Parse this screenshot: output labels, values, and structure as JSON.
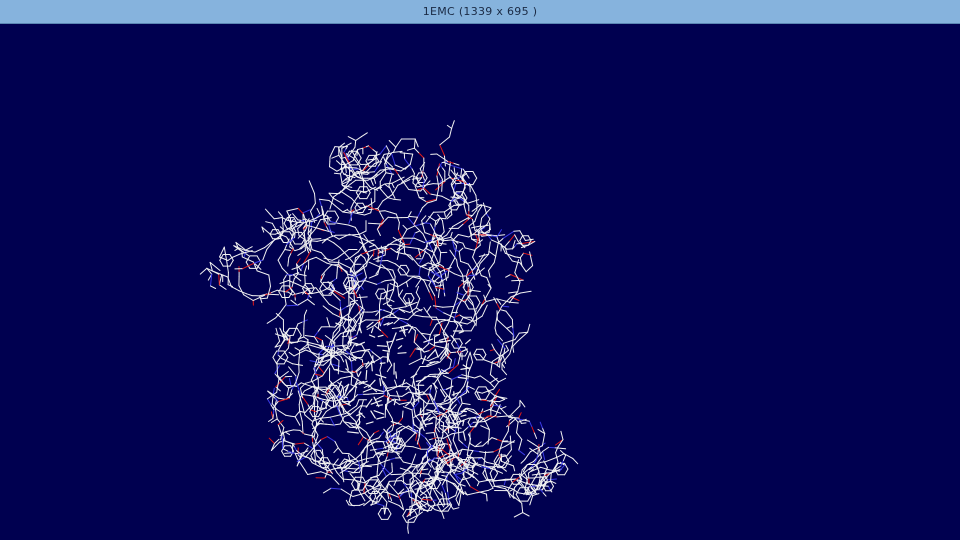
{
  "window": {
    "title": "1EMC  (1339 x 695 )"
  },
  "viewer": {
    "background_color": "#000050",
    "bond_colors": {
      "carbon": "#f2f2f2",
      "oxygen": "#e01818",
      "nitrogen": "#3a3ae6"
    }
  }
}
